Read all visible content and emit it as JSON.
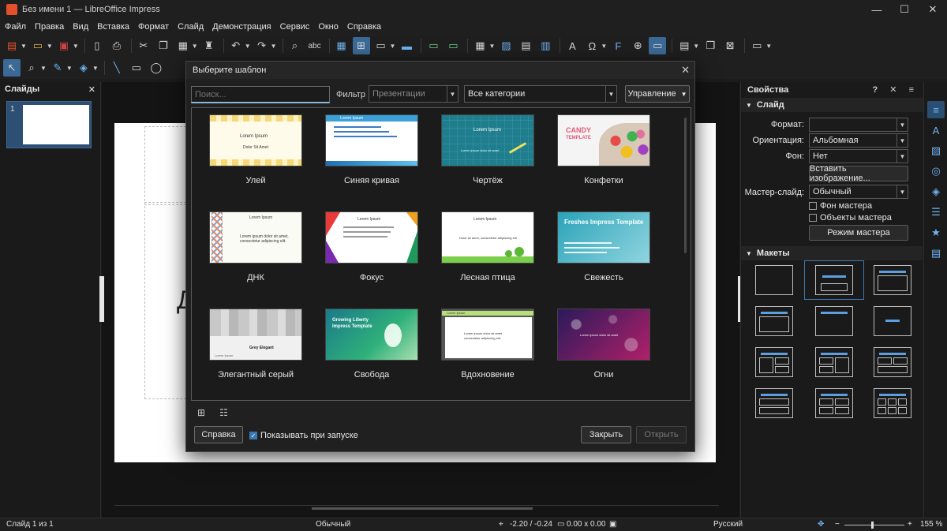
{
  "window": {
    "title": "Без имени 1 — LibreOffice Impress",
    "minimize": "—",
    "maximize": "☐",
    "close": "✕"
  },
  "menu": [
    "Файл",
    "Правка",
    "Вид",
    "Вставка",
    "Формат",
    "Слайд",
    "Демонстрация",
    "Сервис",
    "Окно",
    "Справка"
  ],
  "toolbar1": {
    "icons": [
      "new-icon",
      "open-icon",
      "save-icon",
      "export-pdf-icon",
      "print-icon",
      "cut-icon",
      "copy-icon",
      "paste-icon",
      "clone-format-icon",
      "undo-icon",
      "redo-icon",
      "find-replace-icon",
      "spellcheck-icon",
      "grid-icon",
      "helplines-icon",
      "display-views-icon",
      "master-slide-icon",
      "start-first-icon",
      "start-current-icon",
      "table-icon",
      "image-icon",
      "media-icon",
      "chart-icon",
      "textbox-icon",
      "special-char-icon",
      "fontwork-icon",
      "hyperlink-icon",
      "comment-icon",
      "new-slide-icon",
      "duplicate-slide-icon",
      "delete-slide-icon",
      "slide-layout-icon"
    ],
    "spellcheck_glyph": "abc"
  },
  "slides_panel": {
    "title": "Слайды",
    "close": "✕",
    "slide_number": "1"
  },
  "canvas": {
    "visible_letter": "Д"
  },
  "properties": {
    "title": "Свойства",
    "head_icons": "? ✕ ≡",
    "slide_section": "Слайд",
    "format_label": "Формат:",
    "format_value": "",
    "orientation_label": "Ориентация:",
    "orientation_value": "Альбомная",
    "background_label": "Фон:",
    "background_value": "Нет",
    "insert_image_button": "Вставить изображение...",
    "master_slide_label": "Мастер-слайд:",
    "master_slide_value": "Обычный",
    "master_background_checkbox": "Фон мастера",
    "master_objects_checkbox": "Объекты мастера",
    "master_mode_button": "Режим мастера",
    "layouts_section": "Макеты"
  },
  "dialog": {
    "title": "Выберите шаблон",
    "close": "✕",
    "search_placeholder": "Поиск...",
    "filter_label": "Фильтр",
    "filter_value": "Презентации",
    "category_value": "Все категории",
    "manage_button": "Управление",
    "templates": [
      {
        "name": "Улей",
        "line1": "Lorem Ipsum",
        "line2": "Dolor Sit Amet"
      },
      {
        "name": "Синяя кривая",
        "line1": "Lorem Ipsum",
        "line2": ""
      },
      {
        "name": "Чертёж",
        "line1": "Lorem Ipsum",
        "line2": "Lorem ipsum dolor sit amet"
      },
      {
        "name": "Конфетки",
        "line1": "CANDY",
        "line2": "TEMPLATE"
      },
      {
        "name": "ДНК",
        "line1": "Lorem Ipsum",
        "line2": "Lorem ipsum dolor sit amet, consectetur adipiscing elit."
      },
      {
        "name": "Фокус",
        "line1": "Lorem Ipsum",
        "line2": ""
      },
      {
        "name": "Лесная птица",
        "line1": "Lorem Ipsum",
        "line2": "Dolor sit amet, consectetur adipiscing elit"
      },
      {
        "name": "Свежесть",
        "line1": "Freshes Impress Template",
        "line2": ""
      },
      {
        "name": "Элегантный серый",
        "line1": "Grey Elegant",
        "line2": "Lorem Ipsum"
      },
      {
        "name": "Свобода",
        "line1": "Growing Liberty Impress Template",
        "line2": ""
      },
      {
        "name": "Вдохновение",
        "line1": "Lorem Ipsum",
        "line2": "Lorem ipsum dolor sit amet consectetur adipiscing elit."
      },
      {
        "name": "Огни",
        "line1": "Lorem ipsum dolor sit amet",
        "line2": ""
      }
    ],
    "help_button": "Справка",
    "show_on_startup": "Показывать при запуске",
    "close_button": "Закрыть",
    "open_button": "Открыть"
  },
  "statusbar": {
    "slide_info": "Слайд 1 из 1",
    "master": "Обычный",
    "position": "-2.20 / -0.24",
    "size": "0.00 x 0.00",
    "language": "Русский",
    "zoom_minus": "−",
    "zoom_plus": "+",
    "zoom": "155 %"
  },
  "colors": {
    "accent": "#3b78b0",
    "background": "#1c1c1c",
    "app_icon": "#e2512b"
  }
}
